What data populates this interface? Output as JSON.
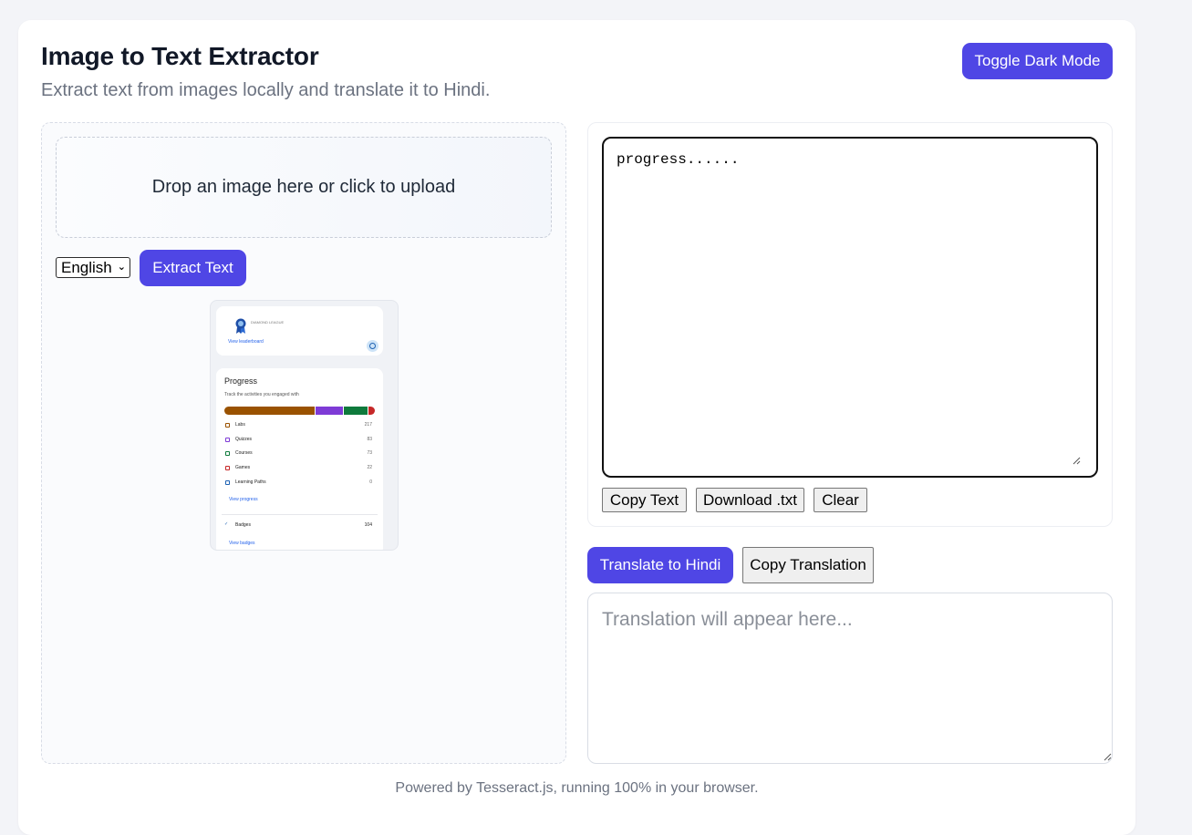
{
  "header": {
    "title": "Image to Text Extractor",
    "subtitle": "Extract text from images locally and translate it to Hindi.",
    "toggle_label": "Toggle Dark Mode"
  },
  "upload": {
    "dropzone_text": "Drop an image here or click to upload",
    "language_selected": "English",
    "extract_label": "Extract Text"
  },
  "preview": {
    "league": "DIAMOND LEAGUE",
    "leaderboard_link": "View leaderboard",
    "progress_title": "Progress",
    "progress_subtitle": "Track the activities you engaged with",
    "progress_segments": [
      {
        "label": "Labs",
        "fraction": 0.6,
        "color": "#9a5200"
      },
      {
        "label": "Quizzes",
        "fraction": 0.19,
        "color": "#7e3bd6"
      },
      {
        "label": "Courses",
        "fraction": 0.16,
        "color": "#0e7a3c"
      },
      {
        "label": "Games",
        "fraction": 0.05,
        "color": "#c62828"
      }
    ],
    "rows": [
      {
        "label": "Labs",
        "value": "217",
        "icon_color": "#9a5200"
      },
      {
        "label": "Quizzes",
        "value": "83",
        "icon_color": "#7e3bd6"
      },
      {
        "label": "Courses",
        "value": "73",
        "icon_color": "#0e7a3c"
      },
      {
        "label": "Games",
        "value": "22",
        "icon_color": "#c62828"
      },
      {
        "label": "Learning Paths",
        "value": "0",
        "icon_color": "#1e62b3"
      }
    ],
    "progress_link": "View progress",
    "badges_label": "Badges",
    "badges_value": "104",
    "badges_link": "View badges"
  },
  "output": {
    "text": "progress......",
    "copy_label": "Copy Text",
    "download_label": "Download .txt",
    "clear_label": "Clear"
  },
  "translation": {
    "translate_label": "Translate to Hindi",
    "copy_label": "Copy Translation",
    "placeholder": "Translation will appear here..."
  },
  "footer": {
    "text": "Powered by Tesseract.js, running 100% in your browser."
  },
  "colors": {
    "accent": "#4f46e5",
    "page_bg": "#f3f4f8",
    "text_muted": "#6b7280"
  }
}
